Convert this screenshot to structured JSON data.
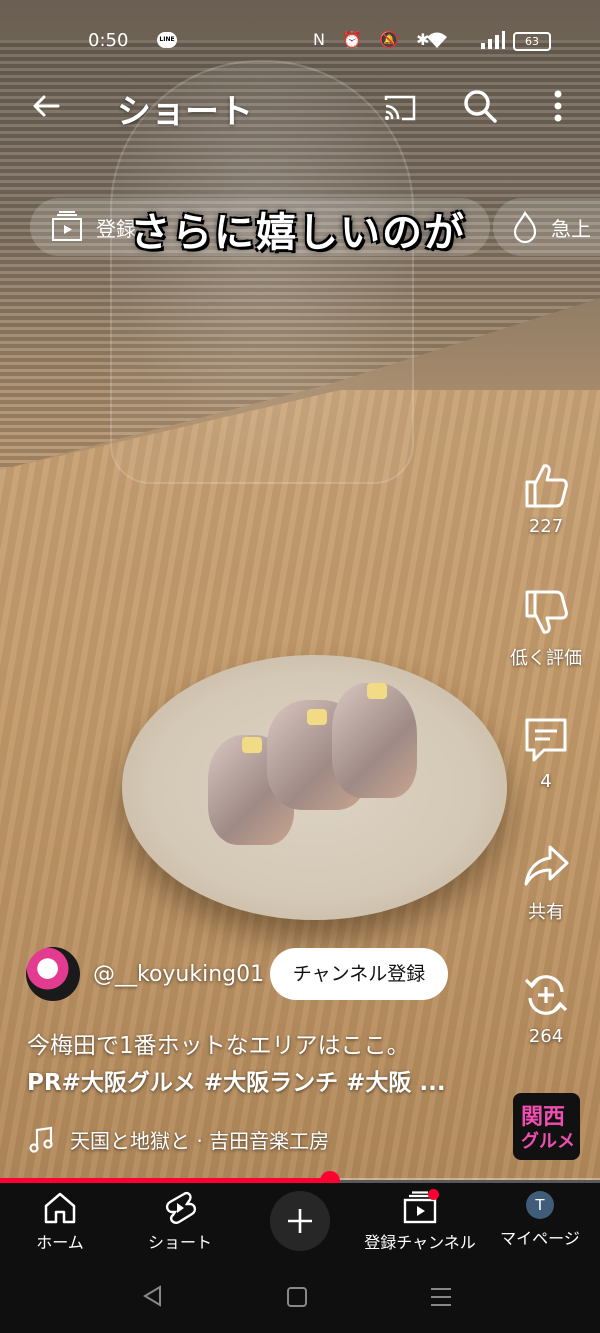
{
  "status_bar": {
    "time": "0:50",
    "line_badge": "LINE",
    "icons": "N ⏰ 🔕 ✱",
    "battery": "63"
  },
  "appbar": {
    "title": "ショート"
  },
  "chips": {
    "subscriptions": "登録",
    "trending": "急上"
  },
  "video": {
    "caption": "さらに嬉しいのが"
  },
  "actions": {
    "like_count": "227",
    "dislike_label": "低く評価",
    "comment_count": "4",
    "share_label": "共有",
    "remix_count": "264"
  },
  "channel": {
    "handle": "@__koyuking01",
    "subscribe_label": "チャンネル登録"
  },
  "description": {
    "line1": "今梅田で1番ホットなエリアはここ。",
    "line2": "PR#大阪グルメ #大阪ランチ #大阪 ..."
  },
  "music": {
    "title": "天国と地獄と · 吉田音楽工房"
  },
  "sound_thumb": {
    "line1": "関西",
    "line2": "グルメ"
  },
  "progress": {
    "fraction": 0.55
  },
  "bottom_nav": {
    "home": "ホーム",
    "shorts": "ショート",
    "subscriptions": "登録チャンネル",
    "me": "マイページ",
    "me_initial": "T"
  },
  "colors": {
    "accent": "#ff0033",
    "nav_bg": "#0f0f0f"
  }
}
